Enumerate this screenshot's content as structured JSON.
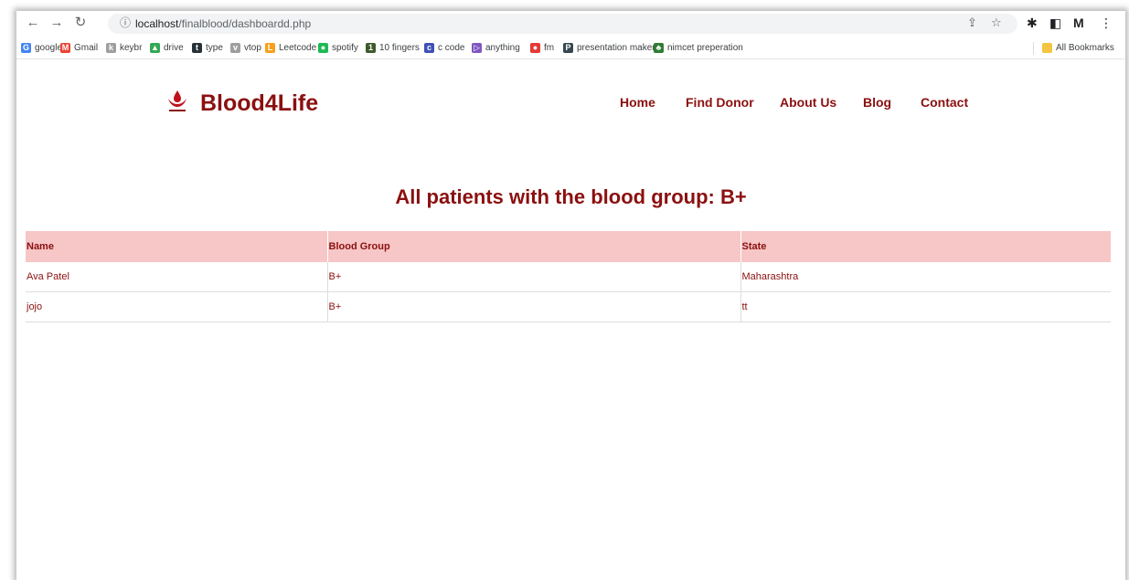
{
  "browser": {
    "url_host": "localhost",
    "url_path": "/finalblood/dashboardd.php",
    "bookmarks": [
      {
        "label": "google",
        "icon": "google-icon",
        "color": "#4285f4",
        "glyph": "G"
      },
      {
        "label": "Gmail",
        "icon": "gmail-icon",
        "color": "#ea4335",
        "glyph": "M"
      },
      {
        "label": "keybr",
        "icon": "keybr-icon",
        "color": "#9e9e9e",
        "glyph": "k"
      },
      {
        "label": "drive",
        "icon": "drive-icon",
        "color": "#34a853",
        "glyph": "▲"
      },
      {
        "label": "type",
        "icon": "type-icon",
        "color": "#263238",
        "glyph": "t"
      },
      {
        "label": "vtop",
        "icon": "vtop-icon",
        "color": "#9e9e9e",
        "glyph": "v"
      },
      {
        "label": "Leetcode",
        "icon": "leetcode-icon",
        "color": "#f89f1b",
        "glyph": "L"
      },
      {
        "label": "spotify",
        "icon": "spotify-icon",
        "color": "#1db954",
        "glyph": "●"
      },
      {
        "label": "10 fingers",
        "icon": "tenfingers-icon",
        "color": "#3d5a2b",
        "glyph": "1"
      },
      {
        "label": "c code",
        "icon": "ccode-icon",
        "color": "#3f51b5",
        "glyph": "c"
      },
      {
        "label": "anything",
        "icon": "anything-icon",
        "color": "#7e57c2",
        "glyph": "▷"
      },
      {
        "label": "fm",
        "icon": "fm-icon",
        "color": "#e53935",
        "glyph": "●"
      },
      {
        "label": "presentation maker",
        "icon": "presentation-icon",
        "color": "#37474f",
        "glyph": "P"
      },
      {
        "label": "nimcet preperation",
        "icon": "nimcet-icon",
        "color": "#2e7d32",
        "glyph": "♣"
      }
    ],
    "all_bookmarks": "All Bookmarks"
  },
  "site": {
    "brand": "Blood4Life",
    "nav": [
      "Home",
      "Find Donor",
      "About Us",
      "Blog",
      "Contact"
    ]
  },
  "page": {
    "title": "All patients with the blood group: B+"
  },
  "table": {
    "headers": [
      "Name",
      "Blood Group",
      "State"
    ],
    "rows": [
      [
        "Ava Patel",
        "B+",
        "Maharashtra"
      ],
      [
        "jojo",
        "B+",
        "tt"
      ]
    ]
  },
  "colors": {
    "brand": "#8b1010",
    "header_bg": "#f7c6c6"
  }
}
